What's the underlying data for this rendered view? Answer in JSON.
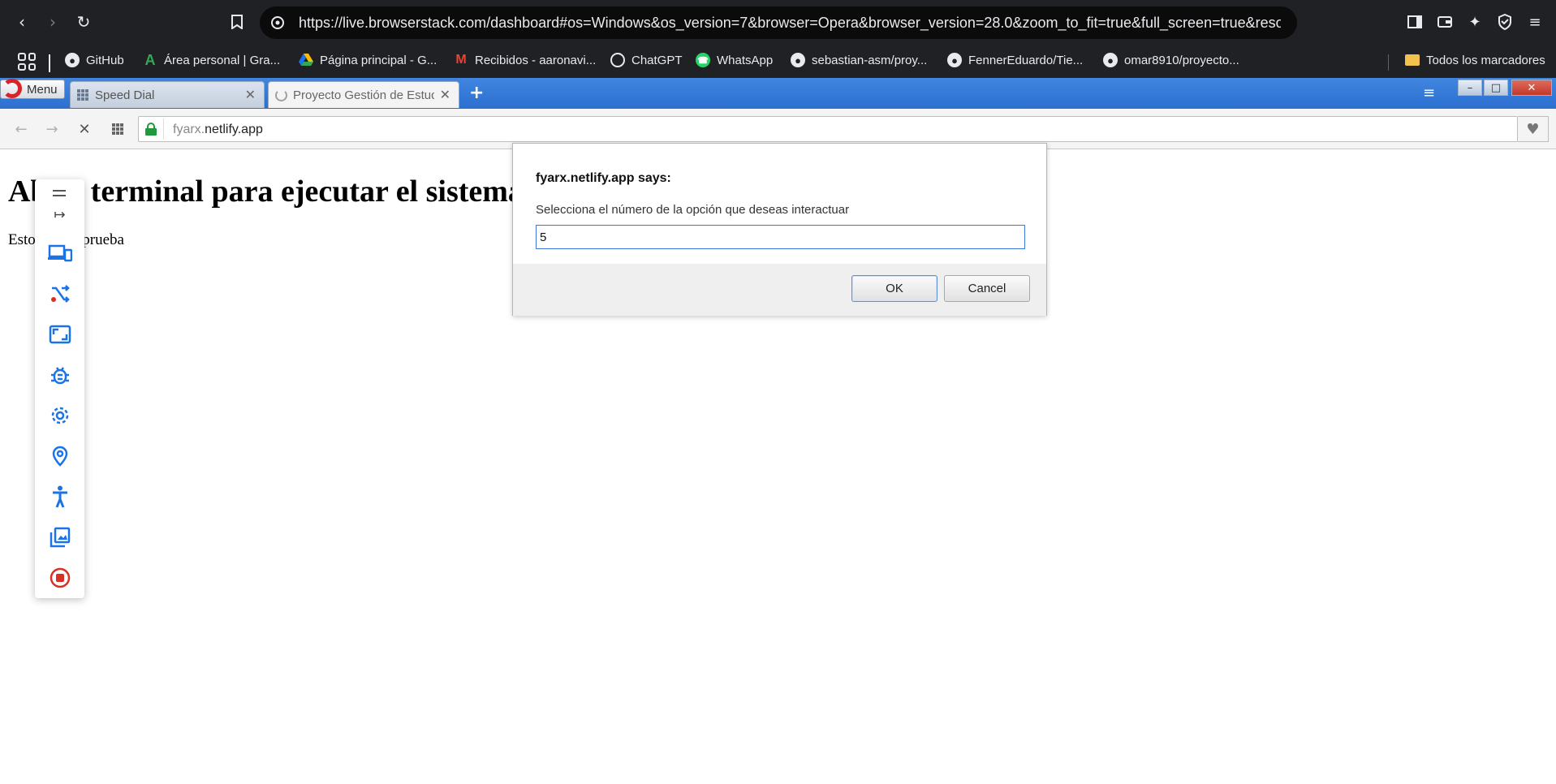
{
  "chrome": {
    "url": "https://live.browserstack.com/dashboard#os=Windows&os_version=7&browser=Opera&browser_version=28.0&zoom_to_fit=true&full_screen=true&resol...",
    "bookmarks": [
      {
        "label": "GitHub",
        "icon": "github-icon"
      },
      {
        "label": "Área personal | Gra...",
        "icon": "atlas-icon"
      },
      {
        "label": "Página principal - G...",
        "icon": "drive-icon"
      },
      {
        "label": "Recibidos - aaronavi...",
        "icon": "gmail-icon"
      },
      {
        "label": "ChatGPT",
        "icon": "chatgpt-icon"
      },
      {
        "label": "WhatsApp",
        "icon": "whatsapp-icon"
      },
      {
        "label": "sebastian-asm/proy...",
        "icon": "github-icon"
      },
      {
        "label": "FennerEduardo/Tie...",
        "icon": "github-icon"
      },
      {
        "label": "omar8910/proyecto...",
        "icon": "github-icon"
      }
    ],
    "all_bookmarks_label": "Todos los marcadores"
  },
  "opera": {
    "menu_label": "Menu",
    "tabs": [
      {
        "label": "Speed Dial"
      },
      {
        "label": "Proyecto Gestión de Estudiantes"
      }
    ],
    "address": {
      "subdomain": "fyarx.",
      "domain": "netlify.app"
    }
  },
  "page": {
    "heading": "Abrir terminal para ejecutar el sistema",
    "paragraph": "Esto es una prueba"
  },
  "dialog": {
    "title": "fyarx.netlify.app says:",
    "message": "Selecciona el número de la opción que deseas interactuar",
    "input_value": "5",
    "ok_label": "OK",
    "cancel_label": "Cancel"
  },
  "colors": {
    "bs_blue": "#1a73e8",
    "bs_red": "#d93025",
    "opera_tabbar": "#2c6fd0",
    "chrome_bg": "#202124"
  }
}
